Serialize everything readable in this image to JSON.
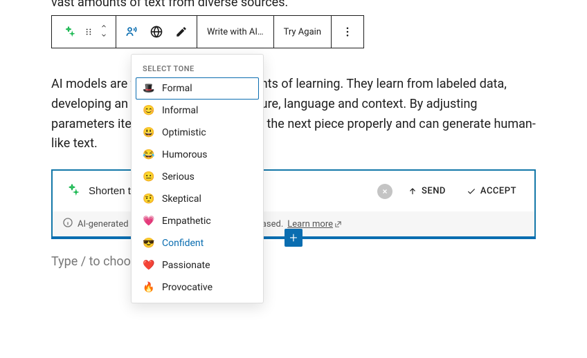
{
  "truncated_line": "vast amounts of text from diverse sources.",
  "toolbar": {
    "write_label": "Write with AI…",
    "tryagain_label": "Try Again"
  },
  "paragraph_text": "AI models are trained with large amounts of learning. They learn from labeled data, developing an understanding of structure, language and context. By adjusting parameters iteratively, they can predict the next piece properly and can generate human-like text.",
  "ai_block": {
    "input_value": "Shorten th",
    "send_label": "SEND",
    "accept_label": "ACCEPT",
    "info_text": "AI-generated content could be inaccurate or biased. ",
    "learn_more": "Learn more"
  },
  "placeholder_text": "Type / to choose a block",
  "tone_menu": {
    "header": "SELECT TONE",
    "items": [
      {
        "emoji": "🎩",
        "label": "Formal",
        "selected": true
      },
      {
        "emoji": "😊",
        "label": "Informal"
      },
      {
        "emoji": "😃",
        "label": "Optimistic"
      },
      {
        "emoji": "😂",
        "label": "Humorous"
      },
      {
        "emoji": "😐",
        "label": "Serious"
      },
      {
        "emoji": "🤨",
        "label": "Skeptical"
      },
      {
        "emoji": "💗",
        "label": "Empathetic"
      },
      {
        "emoji": "😎",
        "label": "Confident",
        "highlight": true
      },
      {
        "emoji": "❤️",
        "label": "Passionate"
      },
      {
        "emoji": "🔥",
        "label": "Provocative"
      }
    ]
  }
}
